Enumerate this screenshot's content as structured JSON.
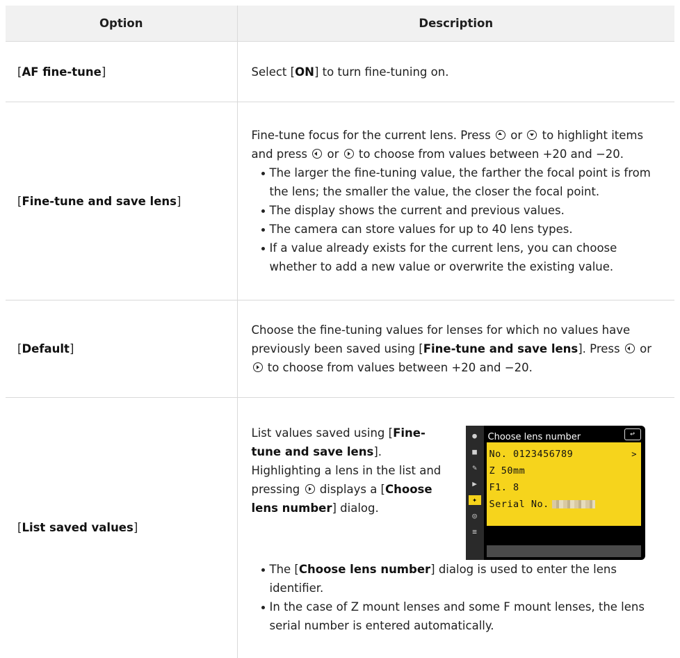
{
  "header": {
    "col_option": "Option",
    "col_description": "Description"
  },
  "rows": {
    "af": {
      "option": "AF fine-tune",
      "desc_prefix": "Select [",
      "desc_bold": "ON",
      "desc_suffix": "] to turn fine-tuning on."
    },
    "save": {
      "option": "Fine-tune and save lens",
      "p1_a": "Fine-tune focus for the current lens. Press",
      "p1_b": "or",
      "p1_c": "to highlight items and press",
      "p1_d": "or",
      "p1_e": "to choose from values between +20 and −20.",
      "bullets": [
        "The larger the fine-tuning value, the farther the focal point is from the lens; the smaller the value, the closer the focal point.",
        "The display shows the current and previous values.",
        "The camera can store values for up to 40 lens types.",
        "If a value already exists for the current lens, you can choose whether to add a new value or overwrite the existing value."
      ]
    },
    "default": {
      "option": "Default",
      "t1": "Choose the fine-tuning values for lenses for which no values have previously been saved using [",
      "t1_bold": "Fine-tune and save lens",
      "t2": "]. Press",
      "t3": "or",
      "t4": "to choose from values between +20 and −20."
    },
    "list": {
      "option": "List saved values",
      "t1": "List values saved using [",
      "t1_bold": "Fine-tune and save lens",
      "t2": "]. Highlighting a lens in the list and pressing",
      "t3": "displays a [",
      "t3_bold": "Choose lens number",
      "t4": "] dialog.",
      "b1_a": "The [",
      "b1_bold": "Choose lens number",
      "b1_b": "] dialog is used to enter the lens identifier.",
      "b2": "In the case of Z mount lenses and some F mount lenses, the lens serial number is entered automatically.",
      "screen": {
        "title": "Choose lens number",
        "line_no": "No. 0123456789",
        "line_z": "Z 50mm",
        "line_f": "F1. 8",
        "line_serial": "Serial No."
      }
    }
  },
  "colors": {
    "header_bg": "#f1f1f1",
    "border": "#d9d9d9",
    "screen_highlight": "#f6d41c"
  }
}
